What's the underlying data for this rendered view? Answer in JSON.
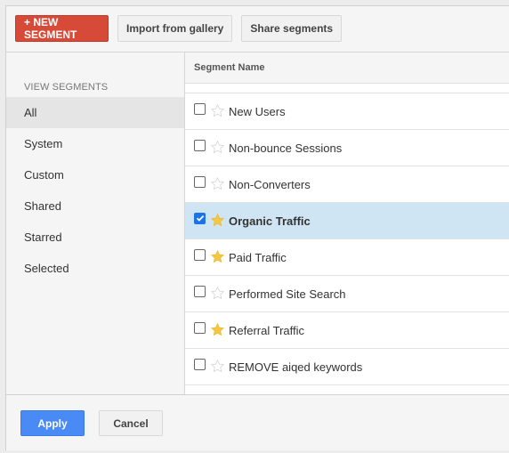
{
  "toolbar": {
    "new_segment_label": "+ NEW SEGMENT",
    "import_label": "Import from gallery",
    "share_label": "Share segments"
  },
  "sidebar": {
    "heading": "VIEW SEGMENTS",
    "items": [
      {
        "label": "All",
        "active": true
      },
      {
        "label": "System",
        "active": false
      },
      {
        "label": "Custom",
        "active": false
      },
      {
        "label": "Shared",
        "active": false
      },
      {
        "label": "Starred",
        "active": false
      },
      {
        "label": "Selected",
        "active": false
      }
    ]
  },
  "table": {
    "column_header": "Segment Name",
    "rows": [
      {
        "name": "New Users",
        "checked": false,
        "starred": false
      },
      {
        "name": "Non-bounce Sessions",
        "checked": false,
        "starred": false
      },
      {
        "name": "Non-Converters",
        "checked": false,
        "starred": false
      },
      {
        "name": "Organic Traffic",
        "checked": true,
        "starred": true
      },
      {
        "name": "Paid Traffic",
        "checked": false,
        "starred": true
      },
      {
        "name": "Performed Site Search",
        "checked": false,
        "starred": false
      },
      {
        "name": "Referral Traffic",
        "checked": false,
        "starred": true
      },
      {
        "name": "REMOVE aiqed keywords",
        "checked": false,
        "starred": false
      }
    ]
  },
  "footer": {
    "apply_label": "Apply",
    "cancel_label": "Cancel"
  },
  "colors": {
    "new_segment": "#d84a38",
    "apply": "#4a8af4",
    "selected_row": "#d0e5f3",
    "star_filled": "#f5c843",
    "star_empty": "#d0d0d0"
  }
}
